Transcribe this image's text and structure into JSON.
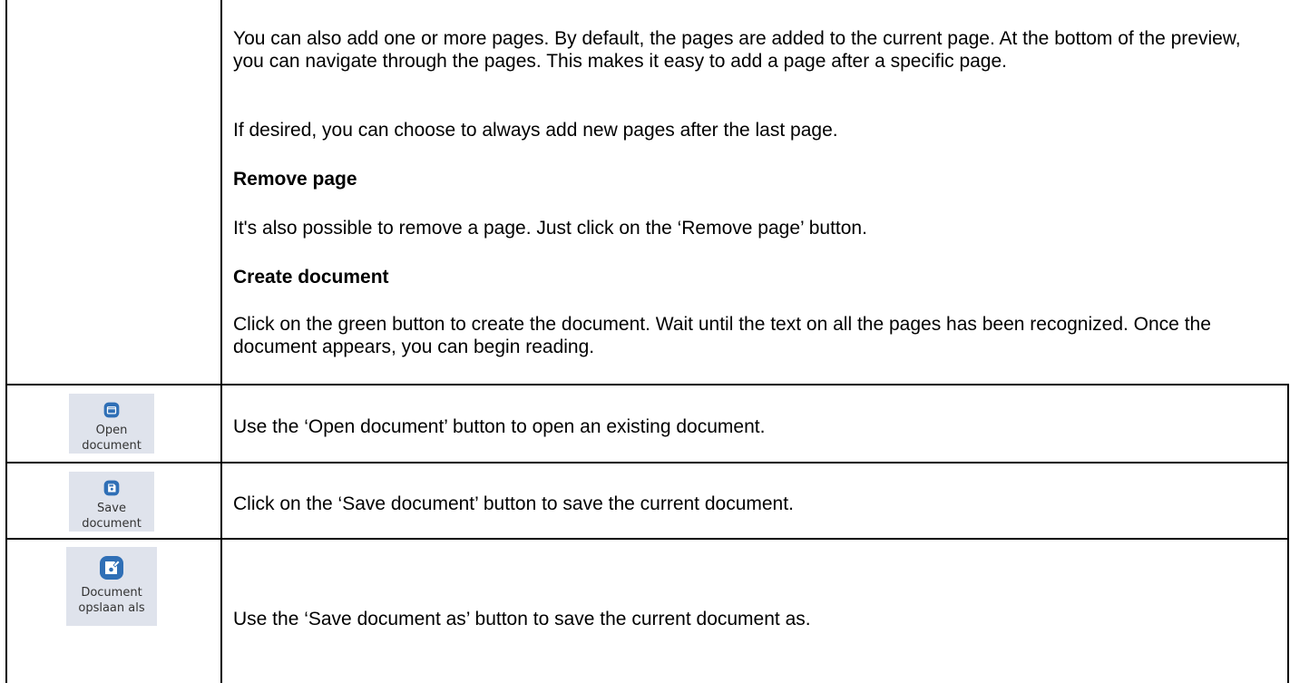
{
  "paragraphs": {
    "add_pages": "You can also add one or more pages. By default, the pages are added to the current page. At the bottom of the preview, you can navigate through the pages. This makes it easy to add a page after a specific page.",
    "last_page": "If desired, you can choose to always add new pages after the last page.",
    "remove_heading": "Remove page",
    "remove_text": "It's also possible to remove a page. Just click on the ‘Remove page’ button.",
    "create_heading": "Create document",
    "create_text": "Click on the green button to create the document. Wait until the text on all the pages has been recognized. Once the document appears, you can begin reading."
  },
  "rows": [
    {
      "icon": "folder-icon",
      "caption": "Open document",
      "description": "Use the ‘Open document’ button to open an existing document."
    },
    {
      "icon": "save-icon",
      "caption": "Save document",
      "description": "Click on the ‘Save document’ button to save the current document."
    },
    {
      "icon": "save-as-icon",
      "caption": "Document opslaan als",
      "description": "Use the ‘Save document as’ button to save the current document as."
    }
  ],
  "colors": {
    "icon_blue": "#2f6fb6",
    "tile_bg": "#dfe3ec"
  }
}
